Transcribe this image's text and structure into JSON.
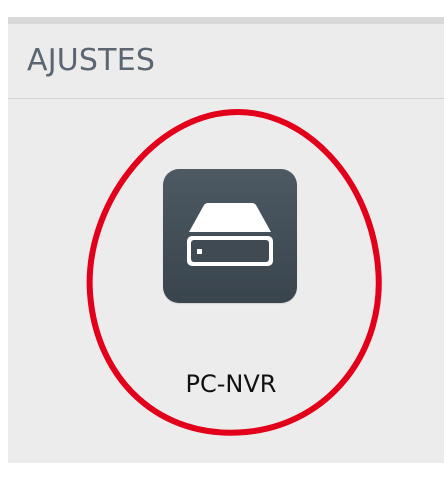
{
  "settings": {
    "title": "AJUSTES"
  },
  "app": {
    "label": "PC-NVR",
    "icon": "drive-icon"
  },
  "colors": {
    "panel_background": "#ececec",
    "panel_top_border": "#d9d9d9",
    "title_text": "#5b6670",
    "icon_background": "#434f58",
    "annotation_ring": "#e2001a"
  }
}
